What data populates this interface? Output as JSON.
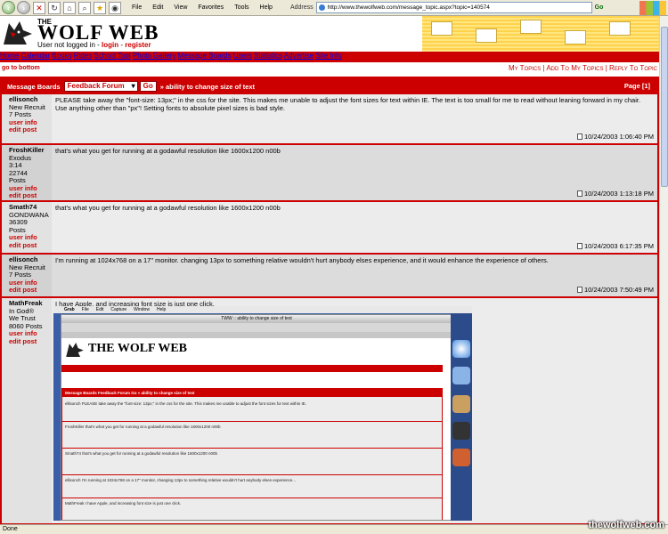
{
  "browser": {
    "menu": [
      "File",
      "Edit",
      "View",
      "Favorites",
      "Tools",
      "Help"
    ],
    "address_label": "Address",
    "url": "http://www.thewolfweb.com/message_topic.aspx?topic=140574",
    "go": "Go",
    "status": "Done"
  },
  "site": {
    "logo_the": "THE",
    "logo_title": "WOLF WEB",
    "login_text": "User not logged in - ",
    "login_link": "login",
    "separator": " - ",
    "register_link": "register"
  },
  "nav": [
    "Home",
    "Calendar",
    "Books",
    "Rides",
    "School Tool",
    "Photo Gallery",
    "Message Boards",
    "Users",
    "Statistics",
    "Advertise",
    "Site Info"
  ],
  "subbar": {
    "goto_bottom": "go to bottom",
    "my_topics": "My Topics",
    "add_to_my_topics": "Add To My Topics",
    "reply_to_topic": "Reply To Topic",
    "sep": " | "
  },
  "board": {
    "label": "Message Boards",
    "forum_select": "Feedback Forum",
    "go": "Go",
    "topic": "» ability to change size of text",
    "page": "Page [1]"
  },
  "posts": [
    {
      "user": "ellisonch",
      "meta": [
        "New Recruit",
        "7 Posts"
      ],
      "text": "PLEASE take away the \"font-size: 13px;\" in the css for the site. This makes me unable to adjust the font sizes for text within IE. The text is too small for me to read without leaning forward in my chair. Use anything other than \"px\"! Setting fonts to absolute pixel sizes is bad style.",
      "time": "10/24/2003 1:06:40 PM"
    },
    {
      "user": "FroshKiller",
      "meta": [
        "Exodus",
        "3:14",
        "22744",
        "Posts"
      ],
      "text": "that's what you get for running at a godawful resolution like 1600x1200 n00b",
      "time": "10/24/2003 1:13:18 PM"
    },
    {
      "user": "Smath74",
      "meta": [
        "GONDWANA",
        "36309",
        "Posts"
      ],
      "text": "that's what you get for running at a godawful resolution like 1600x1200 n00b",
      "time": "10/24/2003 6:17:35 PM"
    },
    {
      "user": "ellisonch",
      "meta": [
        "New Recruit",
        "7 Posts"
      ],
      "text": "I'm running at 1024x768 on a 17\" monitor. changing 13px to something relative wouldn't hurt anybody elses experience, and it would enhance the experience of others.",
      "time": "10/24/2003 7:50:49 PM"
    },
    {
      "user": "MathFreak",
      "meta": [
        "In God®",
        "We Trust",
        "8060 Posts"
      ],
      "text": "I have Apple, and increasing font size is just one click.",
      "time": ""
    }
  ],
  "post_links": {
    "user_info": "user info",
    "edit_post": "edit post"
  },
  "embedded": {
    "mac_menu": [
      "Grab",
      "File",
      "Edit",
      "Capture",
      "Window",
      "Help"
    ],
    "window_title": "TWW :: ability to change size of text",
    "mini_title": "THE WOLF WEB",
    "mini_topic": "Message Boards  Feedback Forum  Go  » ability to change size of text",
    "mini_lines": [
      "ellisonch   PLEASE take away the \"font-size: 13px;\" in the css for the site. This makes me unable to adjust the font sizes for text within IE.",
      "FroshKiller   that's what you get for running at a godawful resolution like 1600x1200 n00b",
      "Smath74   that's what you get for running at a godawful resolution like 1600x1200 n00b",
      "ellisonch   I'm running at 1024x768 on a 17\" monitor, changing 13px to something relative wouldn't hurt anybody elses experience...",
      "MathFreak   I have Apple, and increasing font size is just one click."
    ]
  },
  "watermark": "thewolfweb.com",
  "colors": {
    "brand_red": "#cc0000",
    "banner_yellow": "#ffd24d",
    "post_bg": "#ececec"
  }
}
